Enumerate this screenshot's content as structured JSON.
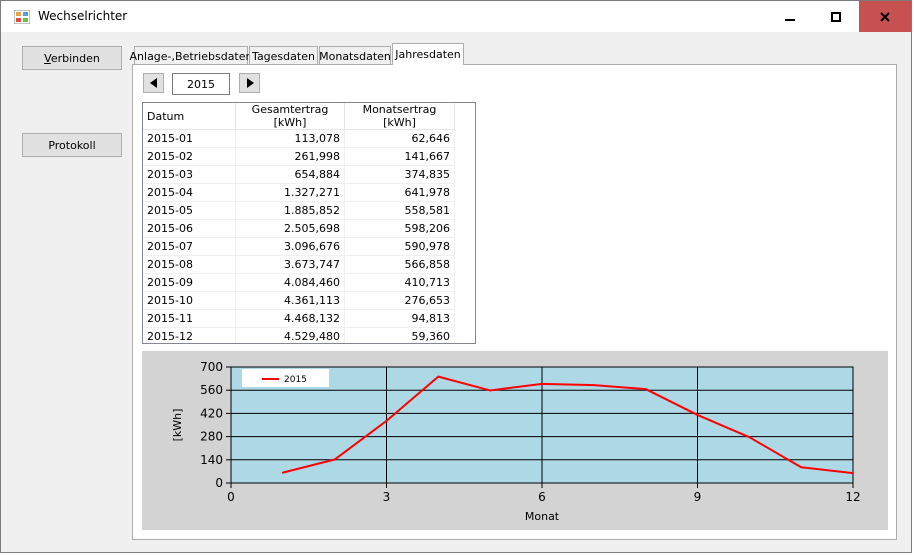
{
  "window": {
    "title": "Wechselrichter",
    "colors": {
      "close_button": "#c75050",
      "titlebar": "#ffffff"
    }
  },
  "buttons": {
    "connect": "Verbinden",
    "log": "Protokoll"
  },
  "tabs": [
    {
      "label": "Anlage-,Betriebsdaten",
      "active": false
    },
    {
      "label": "Tagesdaten",
      "active": false
    },
    {
      "label": "Monatsdaten",
      "active": false
    },
    {
      "label": "Jahresdaten",
      "active": true
    }
  ],
  "year_nav": {
    "prev_icon": "triangle-left-icon",
    "next_icon": "triangle-right-icon",
    "year": "2015"
  },
  "table": {
    "columns": [
      "Datum",
      "Gesamtertrag [kWh]",
      "Monatsertrag [kWh]"
    ],
    "rows": [
      [
        "2015-01",
        "113,078",
        "62,646"
      ],
      [
        "2015-02",
        "261,998",
        "141,667"
      ],
      [
        "2015-03",
        "654,884",
        "374,835"
      ],
      [
        "2015-04",
        "1.327,271",
        "641,978"
      ],
      [
        "2015-05",
        "1.885,852",
        "558,581"
      ],
      [
        "2015-06",
        "2.505,698",
        "598,206"
      ],
      [
        "2015-07",
        "3.096,676",
        "590,978"
      ],
      [
        "2015-08",
        "3.673,747",
        "566,858"
      ],
      [
        "2015-09",
        "4.084,460",
        "410,713"
      ],
      [
        "2015-10",
        "4.361,113",
        "276,653"
      ],
      [
        "2015-11",
        "4.468,132",
        "94,813"
      ],
      [
        "2015-12",
        "4.529,480",
        "59,360"
      ]
    ]
  },
  "chart_data": {
    "type": "line",
    "xlabel": "Monat",
    "ylabel": "[kWh]",
    "xlim": [
      0,
      12
    ],
    "ylim": [
      0,
      700
    ],
    "xticks": [
      0,
      3,
      6,
      9,
      12
    ],
    "yticks": [
      0,
      140,
      280,
      420,
      560,
      700
    ],
    "grid": true,
    "legend_position": "top-left",
    "plot_background": "#add8e6",
    "chart_background": "#d3d3d3",
    "series": [
      {
        "name": "2015",
        "color": "#ff0000",
        "x": [
          1,
          2,
          3,
          4,
          5,
          6,
          7,
          8,
          9,
          10,
          11,
          12
        ],
        "y": [
          62.646,
          141.667,
          374.835,
          641.978,
          558.581,
          598.206,
          590.978,
          566.858,
          410.713,
          276.653,
          94.813,
          59.36
        ]
      }
    ]
  }
}
